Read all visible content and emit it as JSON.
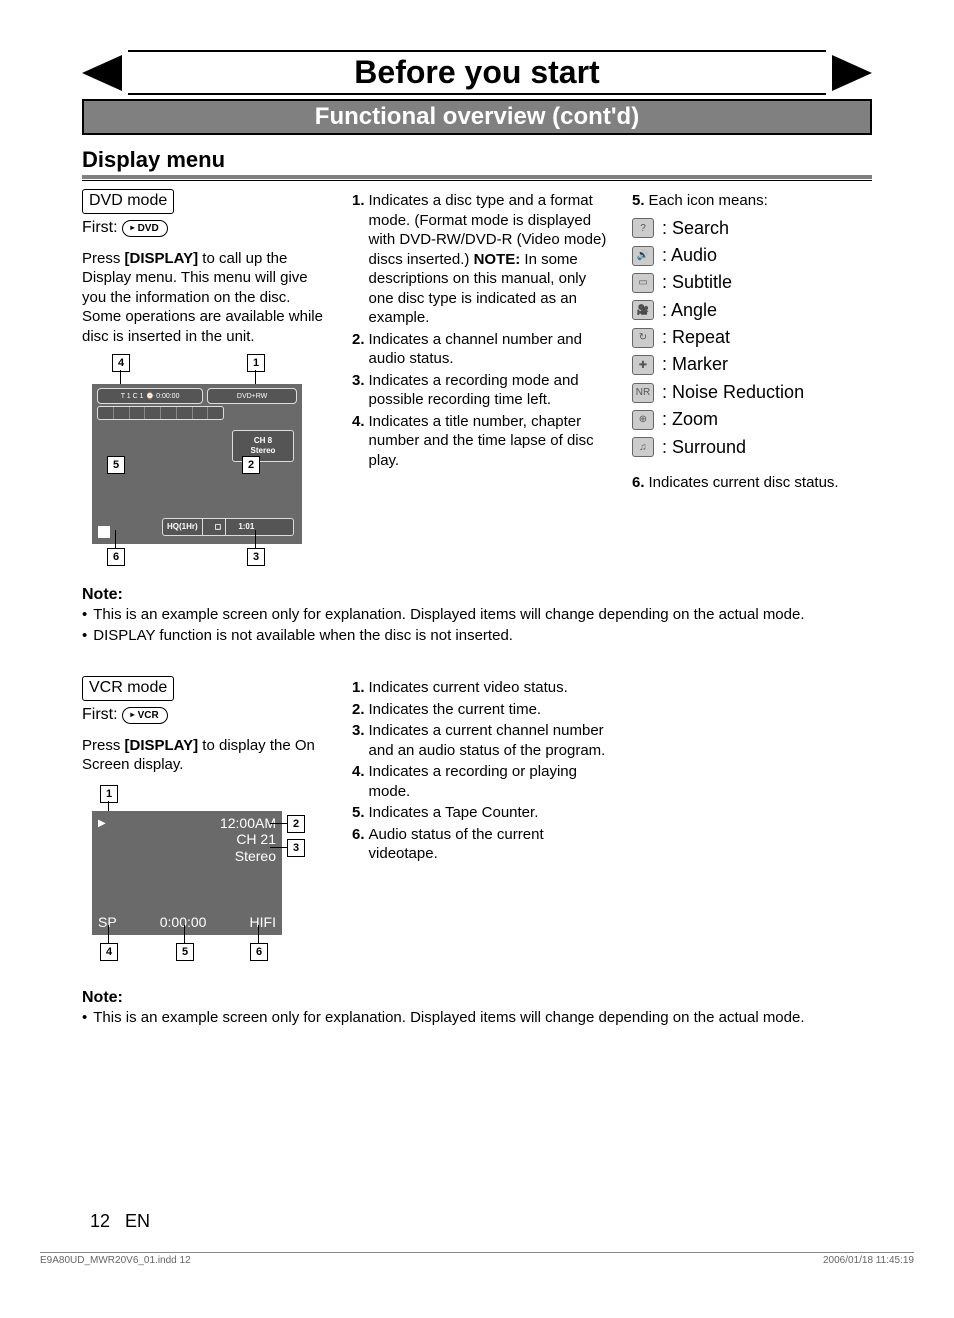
{
  "header": {
    "title": "Before you start",
    "subtitle": "Functional overview (cont'd)"
  },
  "section_head": "Display menu",
  "dvd": {
    "tag": "DVD mode",
    "first": "First:",
    "icon_label": "DVD",
    "intro_pre": "Press ",
    "intro_key": "[DISPLAY]",
    "intro_post": " to call up the Display menu. This menu will give you the information on the disc. Some operations are available while disc is inserted in the unit.",
    "screen": {
      "topbar_left": "T 1 C 1  ⌚ 0:00:00",
      "topbar_right": "DVD+RW",
      "ch_line1": "CH   8",
      "ch_line2": "Stereo",
      "hq_left": "HQ(1Hr)",
      "hq_mid_icon": "◻",
      "hq_right": "1:01"
    },
    "callouts": {
      "c1": "1",
      "c2": "2",
      "c3": "3",
      "c4": "4",
      "c5": "5",
      "c6": "6"
    },
    "col2": [
      {
        "n": "1.",
        "t": "Indicates a disc type and a format mode. (Format mode is displayed with DVD-RW/DVD-R (Video mode) discs inserted.) NOTE: In some descriptions on this manual, only one disc type is indicated as an example.",
        "note": true
      },
      {
        "n": "2.",
        "t": "Indicates a channel number and audio status."
      },
      {
        "n": "3.",
        "t": "Indicates a recording mode and possible recording time left."
      },
      {
        "n": "4.",
        "t": "Indicates a title number, chapter number and the time lapse of disc play."
      }
    ],
    "col3_head": {
      "n": "5.",
      "t": "Each icon means:"
    },
    "icons": [
      {
        "g": "?",
        "label": ": Search",
        "name": "search-icon"
      },
      {
        "g": "🔊",
        "label": ": Audio",
        "name": "audio-icon"
      },
      {
        "g": "▭",
        "label": ": Subtitle",
        "name": "subtitle-icon"
      },
      {
        "g": "🎥",
        "label": ": Angle",
        "name": "angle-icon"
      },
      {
        "g": "↻",
        "label": ": Repeat",
        "name": "repeat-icon"
      },
      {
        "g": "✚",
        "label": ": Marker",
        "name": "marker-icon"
      },
      {
        "g": "NR",
        "label": ": Noise Reduction",
        "name": "noise-reduction-icon"
      },
      {
        "g": "⊕",
        "label": ": Zoom",
        "name": "zoom-icon"
      },
      {
        "g": "♫",
        "label": ": Surround",
        "name": "surround-icon"
      }
    ],
    "col3_tail": {
      "n": "6.",
      "t": "Indicates current disc status."
    },
    "note_head": "Note:",
    "notes": [
      "This is an example screen only for explanation. Displayed items will change depending on the actual mode.",
      "DISPLAY function is not available when the disc is not inserted."
    ]
  },
  "vcr": {
    "tag": "VCR mode",
    "first": "First:",
    "icon_label": "VCR",
    "intro_pre": "Press ",
    "intro_key": "[DISPLAY]",
    "intro_post": " to display the On Screen display.",
    "screen": {
      "time": "12:00AM",
      "ch": "CH 21",
      "stereo": "Stereo",
      "play": "▶",
      "sp": "SP",
      "counter": "0:00:00",
      "hifi": "HIFI"
    },
    "callouts": {
      "c1": "1",
      "c2": "2",
      "c3": "3",
      "c4": "4",
      "c5": "5",
      "c6": "6"
    },
    "col2": [
      {
        "n": "1.",
        "t": "Indicates current video status."
      },
      {
        "n": "2.",
        "t": "Indicates the current time."
      },
      {
        "n": "3.",
        "t": "Indicates a current channel number and an audio status of the program."
      },
      {
        "n": "4.",
        "t": "Indicates a recording or playing mode."
      },
      {
        "n": "5.",
        "t": "Indicates a Tape Counter."
      },
      {
        "n": "6.",
        "t": "Audio status of the current videotape."
      }
    ],
    "note_head": "Note:",
    "notes": [
      "This is an example screen only for explanation. Displayed items will change depending on the actual mode."
    ]
  },
  "footer": {
    "page": "12",
    "lang": "EN",
    "file": "E9A80UD_MWR20V6_01.indd   12",
    "date": "2006/01/18   11:45:19"
  }
}
